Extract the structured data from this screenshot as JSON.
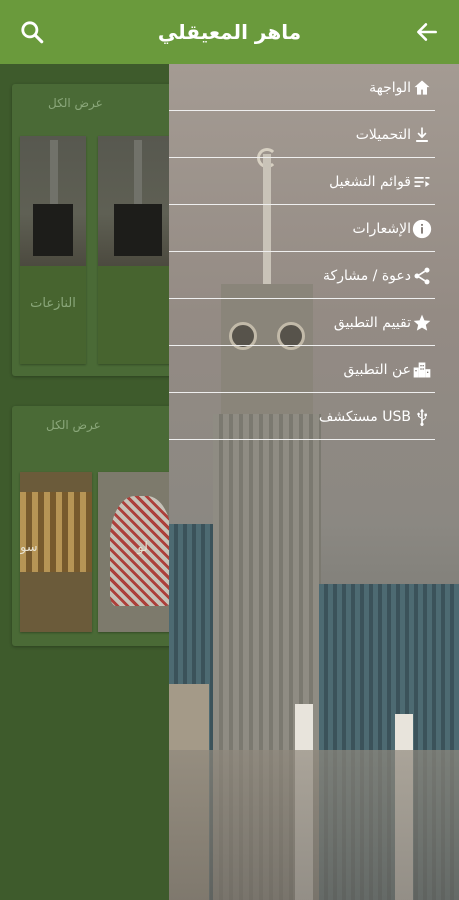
{
  "header": {
    "title": "ماهر المعيقلي"
  },
  "background": {
    "section1": {
      "see_all": "عرض الكل",
      "cards": [
        {
          "label": "النازعات"
        },
        {
          "label": ""
        }
      ]
    },
    "section2": {
      "see_all": "عرض الكل",
      "cards": [
        {
          "label": "سو"
        },
        {
          "label": "لو"
        }
      ]
    }
  },
  "drawer": {
    "items": [
      {
        "label": "الواجهة",
        "icon": "home-icon"
      },
      {
        "label": "التحميلات",
        "icon": "download-icon"
      },
      {
        "label": "قوائم التشغيل",
        "icon": "playlist-icon"
      },
      {
        "label": "الإشعارات",
        "icon": "info-icon"
      },
      {
        "label": "دعوة / مشاركة",
        "icon": "share-icon"
      },
      {
        "label": "تقييم التطبيق",
        "icon": "star-icon"
      },
      {
        "label": "عن التطبيق",
        "icon": "building-icon"
      },
      {
        "label": "مستكشف USB",
        "icon": "usb-icon"
      }
    ]
  },
  "colors": {
    "toolbar": "#6a9a3c",
    "overlay_background": "#3e5b2c",
    "drawer_text": "#ffffff"
  }
}
